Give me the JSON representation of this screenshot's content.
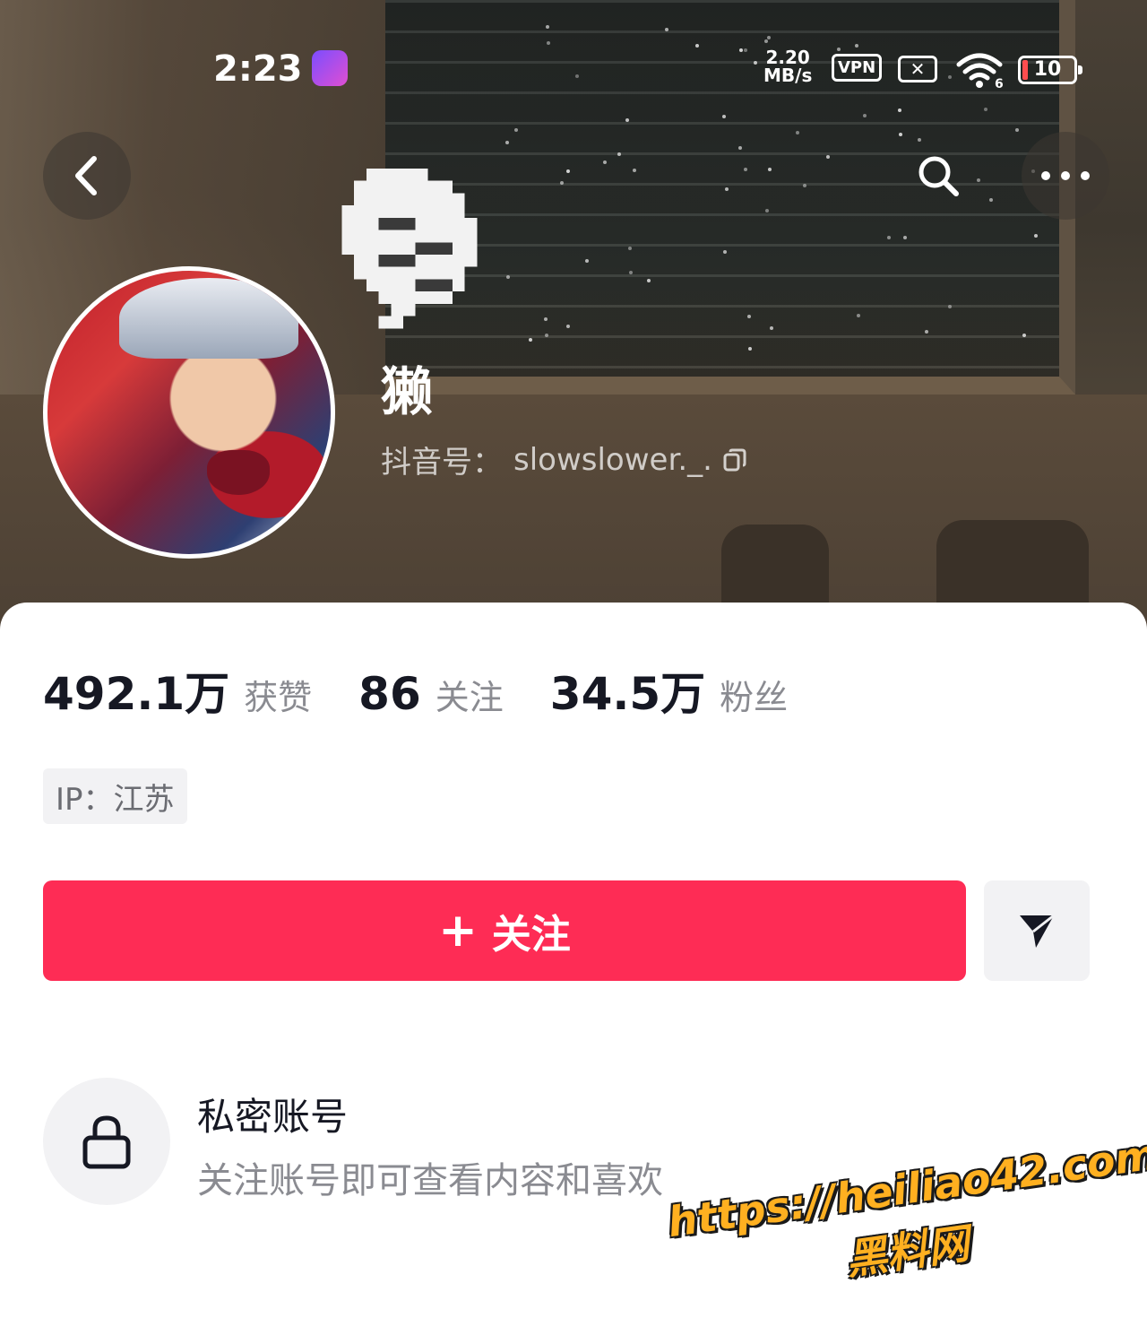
{
  "status_bar": {
    "time": "2:23",
    "net_speed_value": "2.20",
    "net_speed_unit": "MB/s",
    "vpn_label": "VPN",
    "sim_label": "✕",
    "wifi_sub": "6",
    "battery_level": "10"
  },
  "profile": {
    "name": "獭",
    "id_label": "抖音号：",
    "id_value": "slowslower._."
  },
  "stats": [
    {
      "value": "492.1万",
      "label": "获赞"
    },
    {
      "value": "86",
      "label": "关注"
    },
    {
      "value": "34.5万",
      "label": "粉丝"
    }
  ],
  "ip_tag": "IP：江苏",
  "actions": {
    "follow_plus": "+",
    "follow_label": "关注"
  },
  "private_account": {
    "title": "私密账号",
    "subtitle": "关注账号即可查看内容和喜欢"
  },
  "watermark": {
    "url": "https://heiliao42.com",
    "name": "黑料网"
  },
  "colors": {
    "follow_button": "#fe2c55",
    "watermark": "#ffb020"
  },
  "icons": [
    "back-icon",
    "search-icon",
    "more-icon",
    "copy-icon",
    "share-icon",
    "lock-icon",
    "wifi-icon",
    "battery-icon"
  ]
}
